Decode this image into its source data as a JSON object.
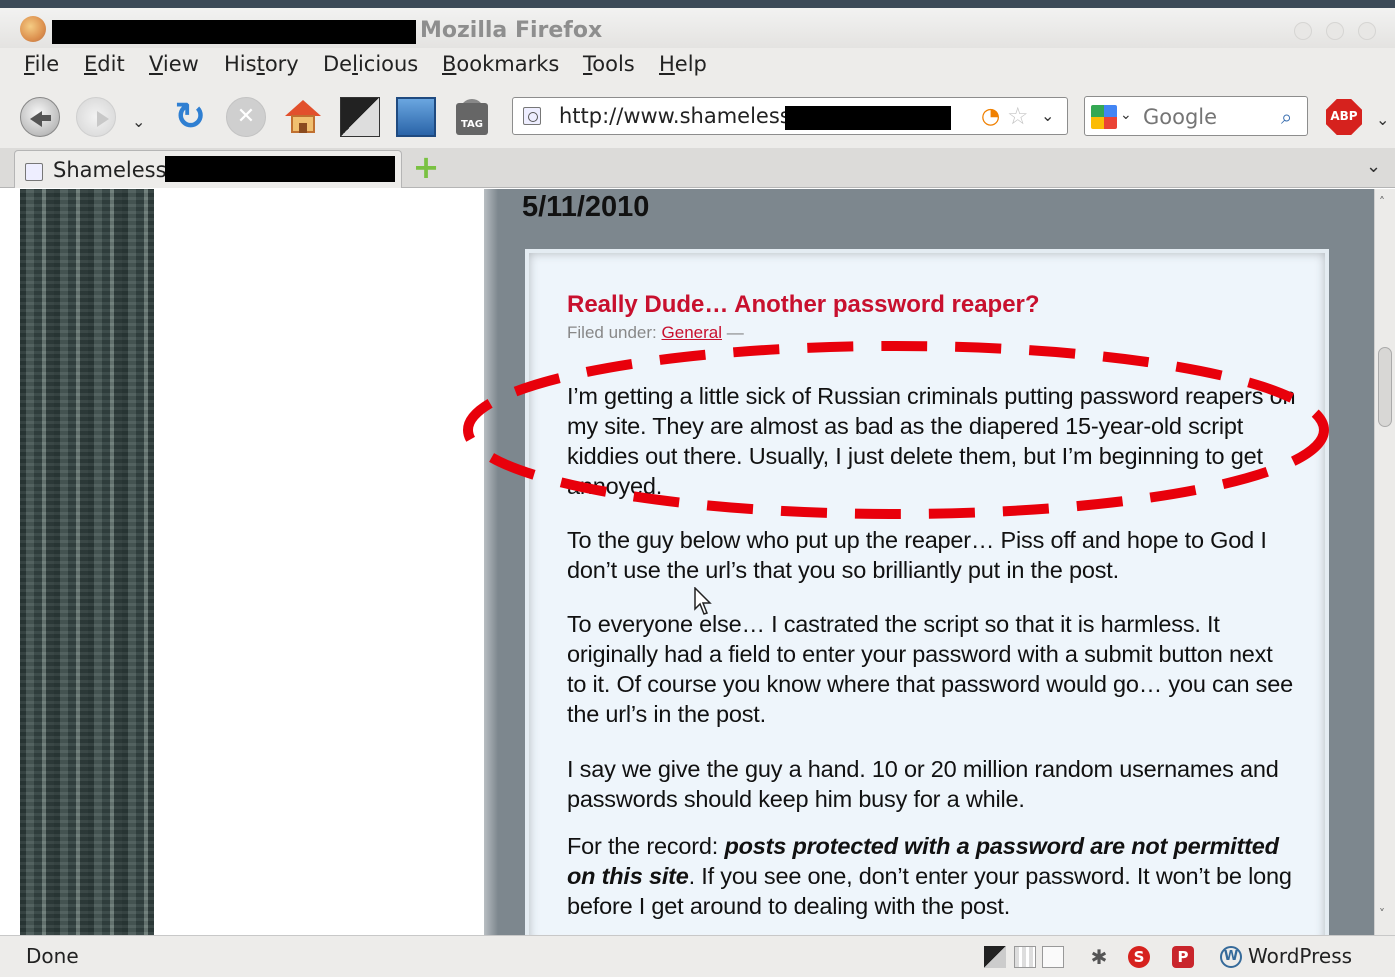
{
  "window": {
    "title": "Mozilla Firefox"
  },
  "menu": [
    "File",
    "Edit",
    "View",
    "History",
    "Delicious",
    "Bookmarks",
    "Tools",
    "Help"
  ],
  "menu_mnemonic_index": [
    0,
    0,
    0,
    3,
    2,
    0,
    0,
    0
  ],
  "address_bar": {
    "url": "http://www.shameless"
  },
  "search": {
    "placeholder": "Google"
  },
  "tab": {
    "title": "Shameless"
  },
  "post": {
    "date": "5/11/2010",
    "title": "Really Dude… Another password reaper?",
    "filed_under_label": "Filed under:",
    "category": "General",
    "dash": "—",
    "paragraphs": [
      "I’m getting a little sick of Russian criminals putting password reapers on my site. They are almost as bad as the diapered 15-year-old script kiddies out there. Usually, I just delete them, but I’m beginning to get annoyed.",
      "To the guy below who put up the reaper… Piss off and hope to God I don’t use the url’s that you so brilliantly put in the post.",
      "To everyone else… I castrated the script so that it is harmless. It originally had a field to enter your password with a submit button next to it. Of course you know where that password would go… you can see the url’s in the post.",
      "I say we give the guy a hand. 10 or 20 million random usernames and passwords should keep him busy for a while."
    ],
    "last_paragraph": {
      "lead": "For the record: ",
      "emphasis": "posts protected with a password are not permitted on this site",
      "rest": ". If you see one, don’t enter your password. It won’t be long before I get around to dealing with the post."
    }
  },
  "status": {
    "text": "Done",
    "wordpress_label": "WordPress"
  },
  "colors": {
    "post_title": "#c8102e",
    "annotation": "#e8000b",
    "page_background": "#7d878e"
  }
}
